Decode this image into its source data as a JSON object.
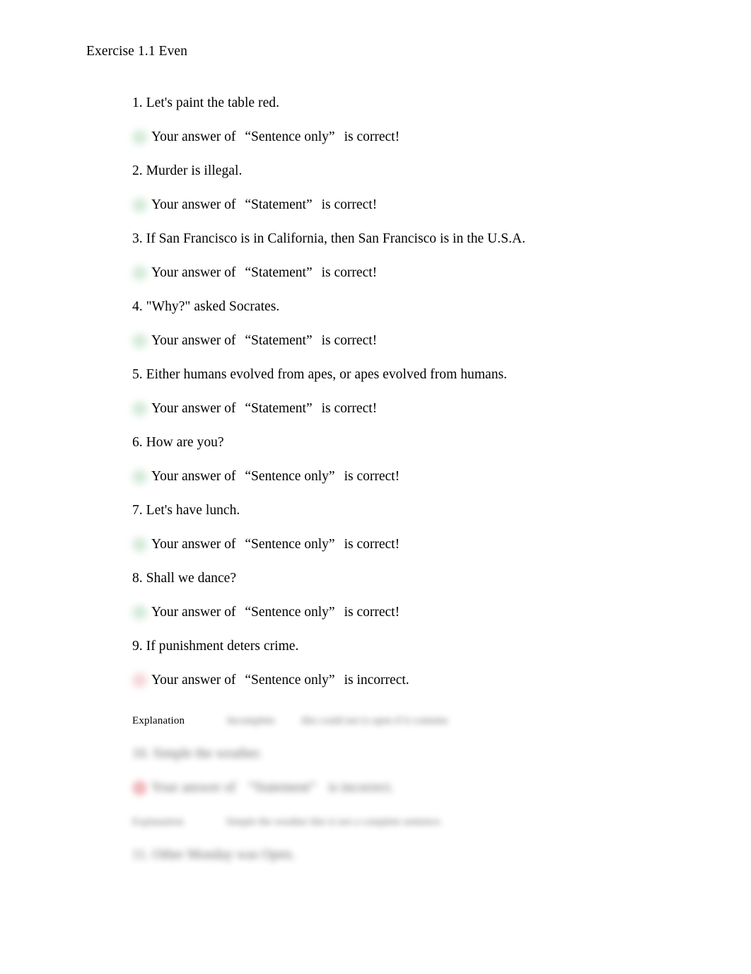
{
  "document": {
    "title": "Exercise 1.1 Even"
  },
  "answer_phrases": {
    "prefix": "Your answer of",
    "suffix_correct": "is correct!",
    "suffix_incorrect": "is incorrect.",
    "open_quote": "“",
    "close_quote": "”"
  },
  "status_colors": {
    "correct": "#cde7d2",
    "incorrect": "#f3cfd2"
  },
  "items": [
    {
      "number": "1.",
      "question": "1. Let's paint the table red.",
      "answer_prefix": "Your answer of",
      "answer_value": "“Sentence only”",
      "answer_suffix": "is correct!",
      "status": "correct"
    },
    {
      "number": "2.",
      "question": "2. Murder is illegal.",
      "answer_prefix": "Your answer of",
      "answer_value": "“Statement”",
      "answer_suffix": "is correct!",
      "status": "correct"
    },
    {
      "number": "3.",
      "question": "3. If San Francisco is in California, then San Francisco is in the U.S.A.",
      "answer_prefix": "Your answer of",
      "answer_value": "“Statement”",
      "answer_suffix": "is correct!",
      "status": "correct"
    },
    {
      "number": "4.",
      "question": "4. \"Why?\" asked Socrates.",
      "answer_prefix": "Your answer of",
      "answer_value": "“Statement”",
      "answer_suffix": "is correct!",
      "status": "correct"
    },
    {
      "number": "5.",
      "question": "5. Either humans evolved from apes, or apes evolved from humans.",
      "answer_prefix": "Your answer of",
      "answer_value": "“Statement”",
      "answer_suffix": "is correct!",
      "status": "correct"
    },
    {
      "number": "6.",
      "question": "6. How are you?",
      "answer_prefix": "Your answer of",
      "answer_value": "“Sentence only”",
      "answer_suffix": "is correct!",
      "status": "correct"
    },
    {
      "number": "7.",
      "question": "7. Let's have lunch.",
      "answer_prefix": "Your answer of",
      "answer_value": "“Sentence only”",
      "answer_suffix": "is correct!",
      "status": "correct"
    },
    {
      "number": "8.",
      "question": "8. Shall we dance?",
      "answer_prefix": "Your answer of",
      "answer_value": "“Sentence only”",
      "answer_suffix": "is correct!",
      "status": "correct"
    },
    {
      "number": "9.",
      "question": "9. If punishment deters crime.",
      "answer_prefix": "Your answer of",
      "answer_value": "“Sentence only”",
      "answer_suffix": "is incorrect.",
      "status": "incorrect"
    }
  ],
  "explanation_section": {
    "label": "Explanation",
    "blurred_text_1": "Incomplete",
    "blurred_text_2": "this could not is open if it contains",
    "blurred_question": "10. Simple the weather.",
    "blurred_answer_prefix": "Your answer of",
    "blurred_answer_value": "“Statement”",
    "blurred_answer_suffix": "is incorrect.",
    "blurred_label_2": "Explanation",
    "blurred_text_3": "Simple the weather this is not a complete sentence.",
    "blurred_question_2": "11. Other Monday was Open."
  }
}
